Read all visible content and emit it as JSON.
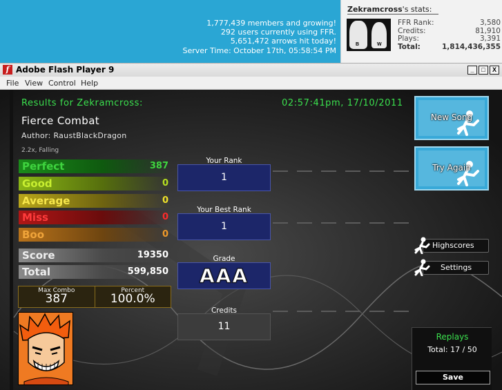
{
  "banner": {
    "members": "1,777,439 members and growing!",
    "online": "292 users currently using FFR.",
    "arrows": "5,651,472 arrows hit today!",
    "server_time": "Server Time: October 17th, 05:58:54 PM"
  },
  "profile": {
    "username": "Zekramcross",
    "title_suffix": "'s stats:",
    "avatar_b": "B",
    "avatar_w": "W",
    "stats": [
      {
        "label": "FFR Rank:",
        "value": "3,580"
      },
      {
        "label": "Credits:",
        "value": "81,910"
      },
      {
        "label": "Plays:",
        "value": "3,391"
      },
      {
        "label": "Total:",
        "value": "1,814,436,355"
      }
    ]
  },
  "window": {
    "title": "Adobe Flash Player 9",
    "minimize": "_",
    "maximize": "□",
    "close": "X",
    "menu": [
      "File",
      "View",
      "Control",
      "Help"
    ]
  },
  "results": {
    "header": "Results for Zekramcross:",
    "timestamp": "02:57:41pm, 17/10/2011",
    "song": "Fierce Combat",
    "author": "Author: RaustBlackDragon",
    "mods": "2.2x, Falling",
    "judgements": [
      {
        "label": "Perfect",
        "value": "387",
        "color": "#38d43a"
      },
      {
        "label": "Good",
        "value": "0",
        "color": "#b6e020"
      },
      {
        "label": "Average",
        "value": "0",
        "color": "#f0e22a"
      },
      {
        "label": "Miss",
        "value": "0",
        "color": "#ff2a2a"
      },
      {
        "label": "Boo",
        "value": "0",
        "color": "#f09a2a"
      }
    ],
    "score_label": "Score",
    "score": "19350",
    "total_label": "Total",
    "total": "599,850",
    "max_combo_label": "Max Combo",
    "max_combo": "387",
    "percent_label": "Percent",
    "percent": "100.0%"
  },
  "ranks": {
    "your_rank_label": "Your Rank",
    "your_rank": "1",
    "best_rank_label": "Your Best Rank",
    "best_rank": "1",
    "grade_label": "Grade",
    "grade": "AAA",
    "credits_label": "Credits",
    "credits": "11"
  },
  "actions": {
    "new_song": "New Song",
    "try_again": "Try Again",
    "highscores": "Highscores",
    "settings": "Settings"
  },
  "replays": {
    "title": "Replays",
    "total": "Total: 17 / 50",
    "save": "Save"
  }
}
